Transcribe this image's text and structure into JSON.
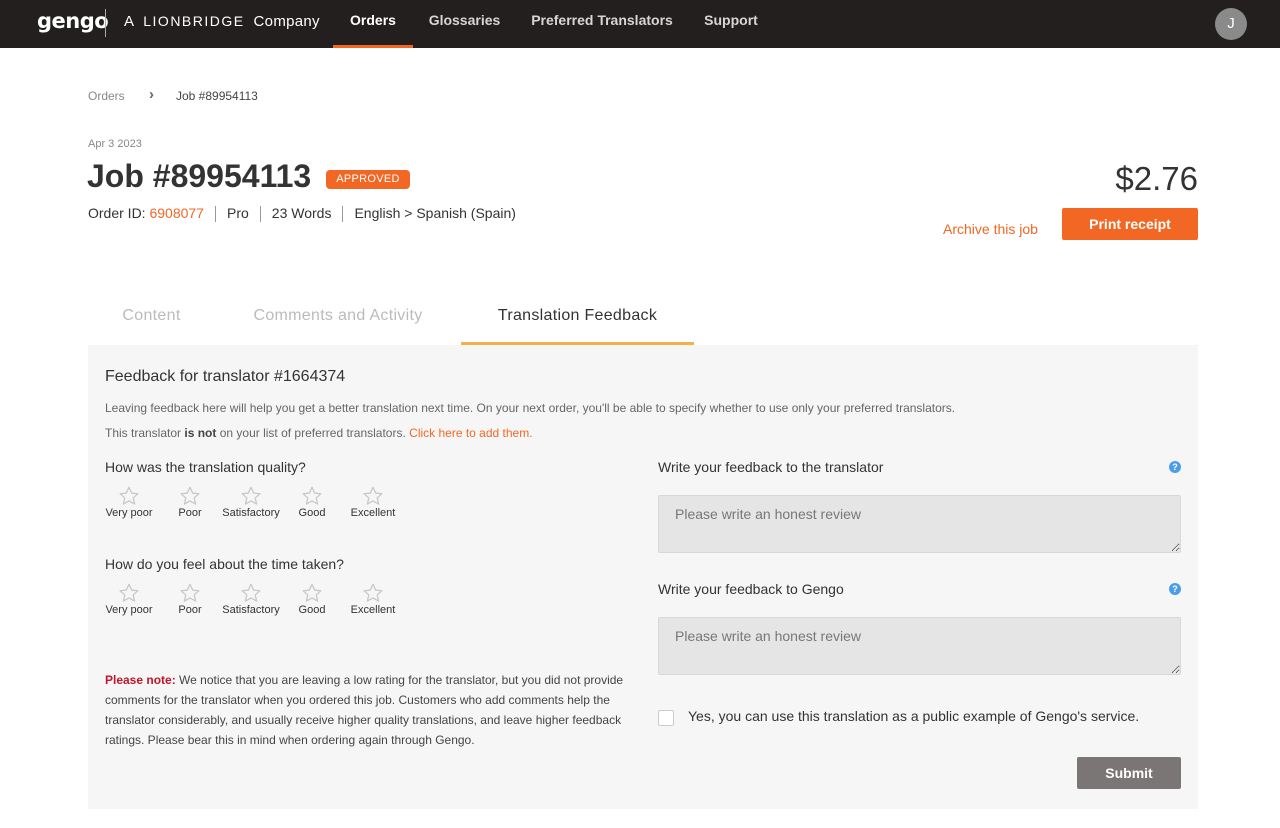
{
  "nav": {
    "logo": "gengo",
    "tagline_prefix": "A",
    "tagline_brand": "LIONBRIDGE",
    "tagline_suffix": "Company",
    "items": [
      {
        "label": "Orders",
        "active": true
      },
      {
        "label": "Glossaries",
        "active": false
      },
      {
        "label": "Preferred Translators",
        "active": false
      },
      {
        "label": "Support",
        "active": false
      }
    ],
    "avatar_initial": "J",
    "accent_color": "#f26724"
  },
  "breadcrumb": {
    "root": "Orders",
    "separator_icon": "chevron-right-icon",
    "current": "Job #89954113"
  },
  "job": {
    "date": "Apr 3 2023",
    "title": "Job #89954113",
    "status": "APPROVED",
    "order_id_label": "Order ID:",
    "order_id": "6908077",
    "tier": "Pro",
    "words": "23 Words",
    "language_pair": "English > Spanish (Spain)",
    "price": "$2.76",
    "archive_label": "Archive this job",
    "print_label": "Print receipt"
  },
  "tabs": [
    {
      "label": "Content",
      "active": false
    },
    {
      "label": "Comments and Activity",
      "active": false
    },
    {
      "label": "Translation Feedback",
      "active": true
    }
  ],
  "feedback": {
    "title": "Feedback for translator #1664374",
    "description": "Leaving feedback here will help you get a better translation next time. On your next order, you'll be able to specify whether to use only your preferred translators.",
    "preferred_prefix": "This translator",
    "preferred_bold": "is not",
    "preferred_suffix": "on your list of preferred translators.",
    "preferred_link": "Click here to add them.",
    "quality_question": "How was the translation quality?",
    "time_question": "How do you feel about the time taken?",
    "rating_labels": [
      "Very poor",
      "Poor",
      "Satisfactory",
      "Good",
      "Excellent"
    ],
    "quality_rating": 0,
    "time_rating": 0,
    "note_prefix": "Please note:",
    "note_text": "We notice that you are leaving a low rating for the translator, but you did not provide comments for the translator when you ordered this job. Customers who add comments help the translator considerably, and usually receive higher quality translations, and leave higher feedback ratings. Please bear this in mind when ordering again through Gengo.",
    "translator_label": "Write your feedback to the translator",
    "translator_placeholder": "Please write an honest review",
    "gengo_label": "Write your feedback to Gengo",
    "gengo_placeholder": "Please write an honest review",
    "help_icon": "question-circle-icon",
    "public_example_label": "Yes, you can use this translation as a public example of Gengo's service.",
    "public_example_checked": false,
    "submit_label": "Submit"
  }
}
